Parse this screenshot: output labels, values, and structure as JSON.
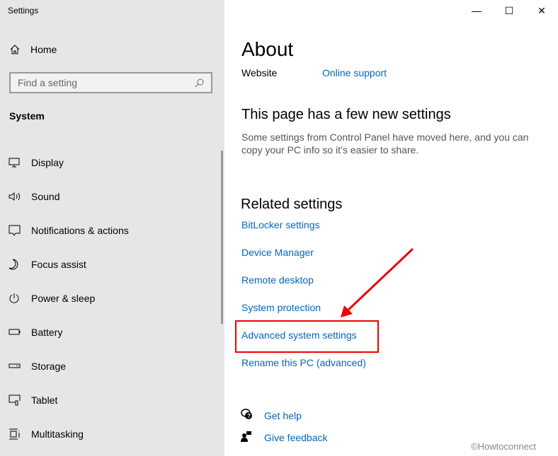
{
  "window": {
    "title": "Settings",
    "minimize": "—",
    "maximize": "☐",
    "close": "✕"
  },
  "sidebar": {
    "home": "Home",
    "search_placeholder": "Find a setting",
    "section": "System",
    "items": [
      {
        "label": "Display",
        "icon": "display-icon"
      },
      {
        "label": "Sound",
        "icon": "sound-icon"
      },
      {
        "label": "Notifications & actions",
        "icon": "notifications-icon"
      },
      {
        "label": "Focus assist",
        "icon": "moon-icon"
      },
      {
        "label": "Power & sleep",
        "icon": "power-icon"
      },
      {
        "label": "Battery",
        "icon": "battery-icon"
      },
      {
        "label": "Storage",
        "icon": "storage-icon"
      },
      {
        "label": "Tablet",
        "icon": "tablet-icon"
      },
      {
        "label": "Multitasking",
        "icon": "multitasking-icon"
      }
    ]
  },
  "main": {
    "title": "About",
    "website_label": "Website",
    "online_support": "Online support",
    "new_settings_title": "This page has a few new settings",
    "new_settings_desc": "Some settings from Control Panel have moved here, and you can copy your PC info so it’s easier to share.",
    "related_title": "Related settings",
    "related": [
      "BitLocker settings",
      "Device Manager",
      "Remote desktop",
      "System protection",
      "Advanced system settings",
      "Rename this PC (advanced)"
    ],
    "get_help": "Get help",
    "give_feedback": "Give feedback"
  },
  "watermark": "©Howtoconnect",
  "colors": {
    "link": "#0067c0",
    "annotation": "#e00000",
    "sidebar": "#e6e6e6"
  }
}
